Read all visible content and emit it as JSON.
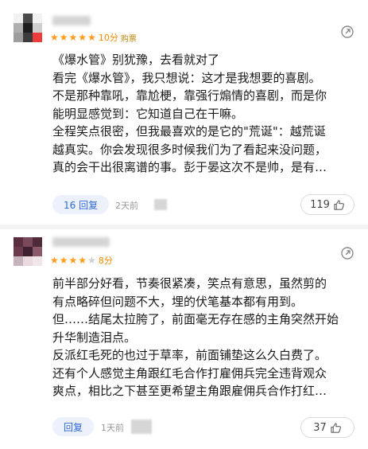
{
  "reviews": [
    {
      "avatar_colors": [
        "#f2f2f2",
        "#4a4a4a",
        "#f2f2f2",
        "#b0b0b0",
        "#1e1e1e",
        "#cfcfcf",
        "#9e9e9e",
        "#3c3c3c",
        "#ee3b3b"
      ],
      "stars_filled": 5,
      "score": "10分",
      "tag": "购票",
      "lines": [
        "《爆水管》别犹豫，去看就对了",
        "看完《爆水管》，我只想说：这才是我想要的喜剧。",
        "不是那种靠吼，靠尬梗，靠强行煽情的喜剧，而是你",
        "能明显感觉到：它知道自己在干嘛。",
        "全程笑点很密，但我最喜欢的是它的\"荒诞\"：越荒诞",
        "越真实。你会发现很多时候我们为了看起来没问题，",
        "真的会干出很离谱的事。彭于晏这次不是帅，是有…"
      ],
      "reply_label": "16 回复",
      "time": "2天前",
      "likes": "119"
    },
    {
      "avatar_colors": [
        "#5a2e3e",
        "#7b4a5a",
        "#4e2a3a",
        "#6b3b4c",
        "#3f2030",
        "#8a5a6a",
        "#c7b3bb",
        "#ead9df",
        "#f1e6ea"
      ],
      "stars_filled": 4,
      "score": "8分",
      "tag": "",
      "lines": [
        "前半部分好看，节奏很紧凑，笑点有意思，虽然剪的",
        "有点略碎但问题不大，埋的伏笔基本都有用到。",
        "但……结尾太拉胯了，前面毫无存在感的主角突然开始",
        "升华制造泪点。",
        "反派红毛死的也过于草率，前面铺垫这么久白费了。",
        "还有个人感觉主角跟红毛合作打雇佣兵完全违背观众",
        "爽点，相比之下甚至更希望主角跟雇佣兵合作打红…"
      ],
      "reply_label": "回复",
      "time": "1天前",
      "likes": "37"
    }
  ],
  "icons": {
    "share": "share-icon",
    "like": "thumbs-up-icon",
    "star": "star-icon"
  },
  "colors": {
    "star": "#ff9a1a",
    "score": "#ff8a00",
    "reply_text": "#2f6ad8",
    "reply_bg": "#edf1fb"
  }
}
